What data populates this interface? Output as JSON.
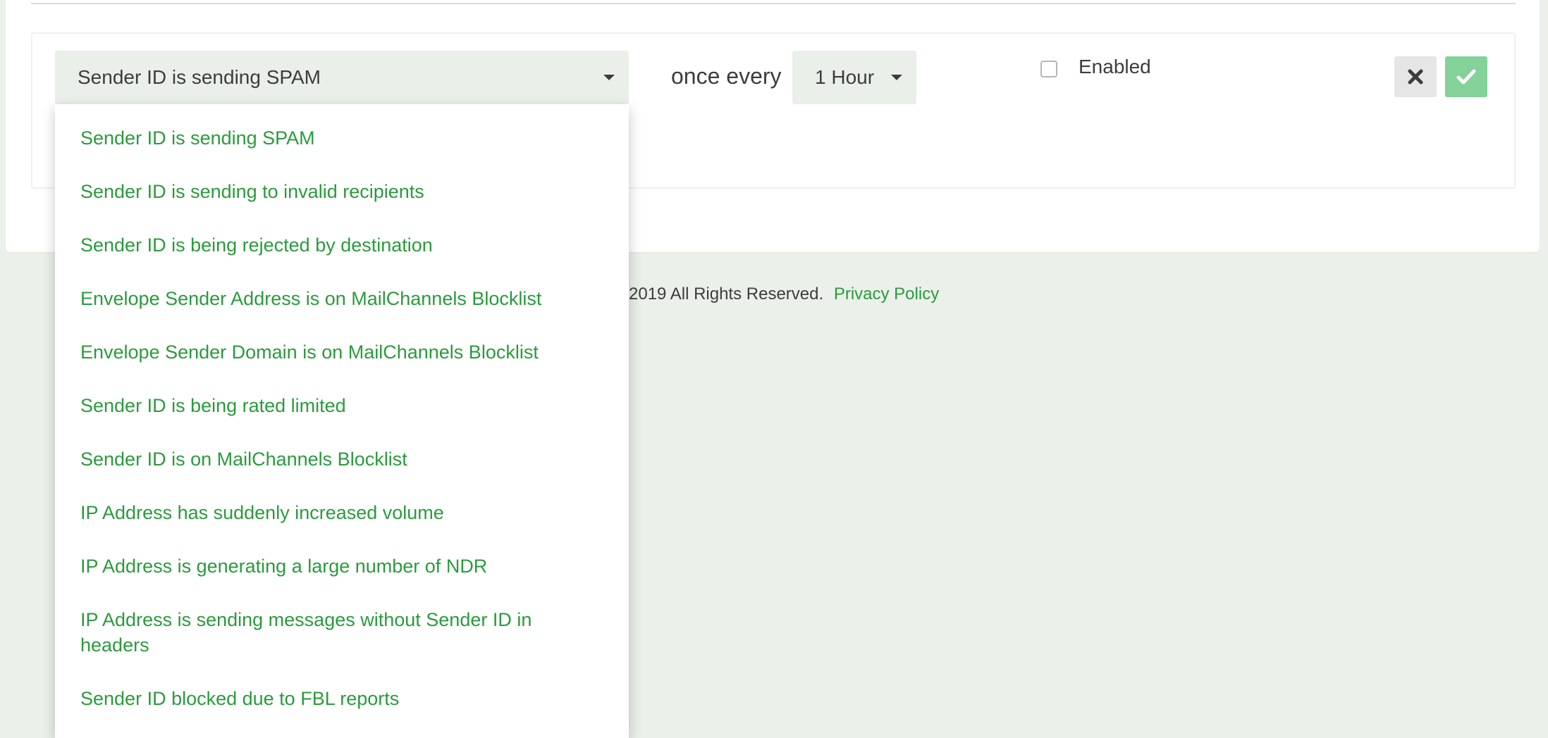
{
  "rule": {
    "condition_selected": "Sender ID is sending SPAM",
    "once_every_label": "once every",
    "interval_selected": "1 Hour",
    "enabled_label": "Enabled",
    "enabled_checked": false
  },
  "dropdown": {
    "options": [
      "Sender ID is sending SPAM",
      "Sender ID is sending to invalid recipients",
      "Sender ID is being rejected by destination",
      "Envelope Sender Address is on MailChannels Blocklist",
      "Envelope Sender Domain is on MailChannels Blocklist",
      "Sender ID is being rated limited",
      "Sender ID is on MailChannels Blocklist",
      "IP Address has suddenly increased volume",
      "IP Address is generating a large number of NDR",
      "IP Address is sending messages without Sender ID in headers",
      "Sender ID blocked due to FBL reports"
    ]
  },
  "footer": {
    "copyright_text": "2019 All Rights Reserved.",
    "privacy_link": "Privacy Policy"
  },
  "colors": {
    "accent_green": "#2a9b3c",
    "save_button_green": "#84d199",
    "page_background": "#ebf0ea"
  },
  "icons": {
    "cancel": "close-icon",
    "save": "check-icon",
    "caret": "caret-down-icon"
  }
}
